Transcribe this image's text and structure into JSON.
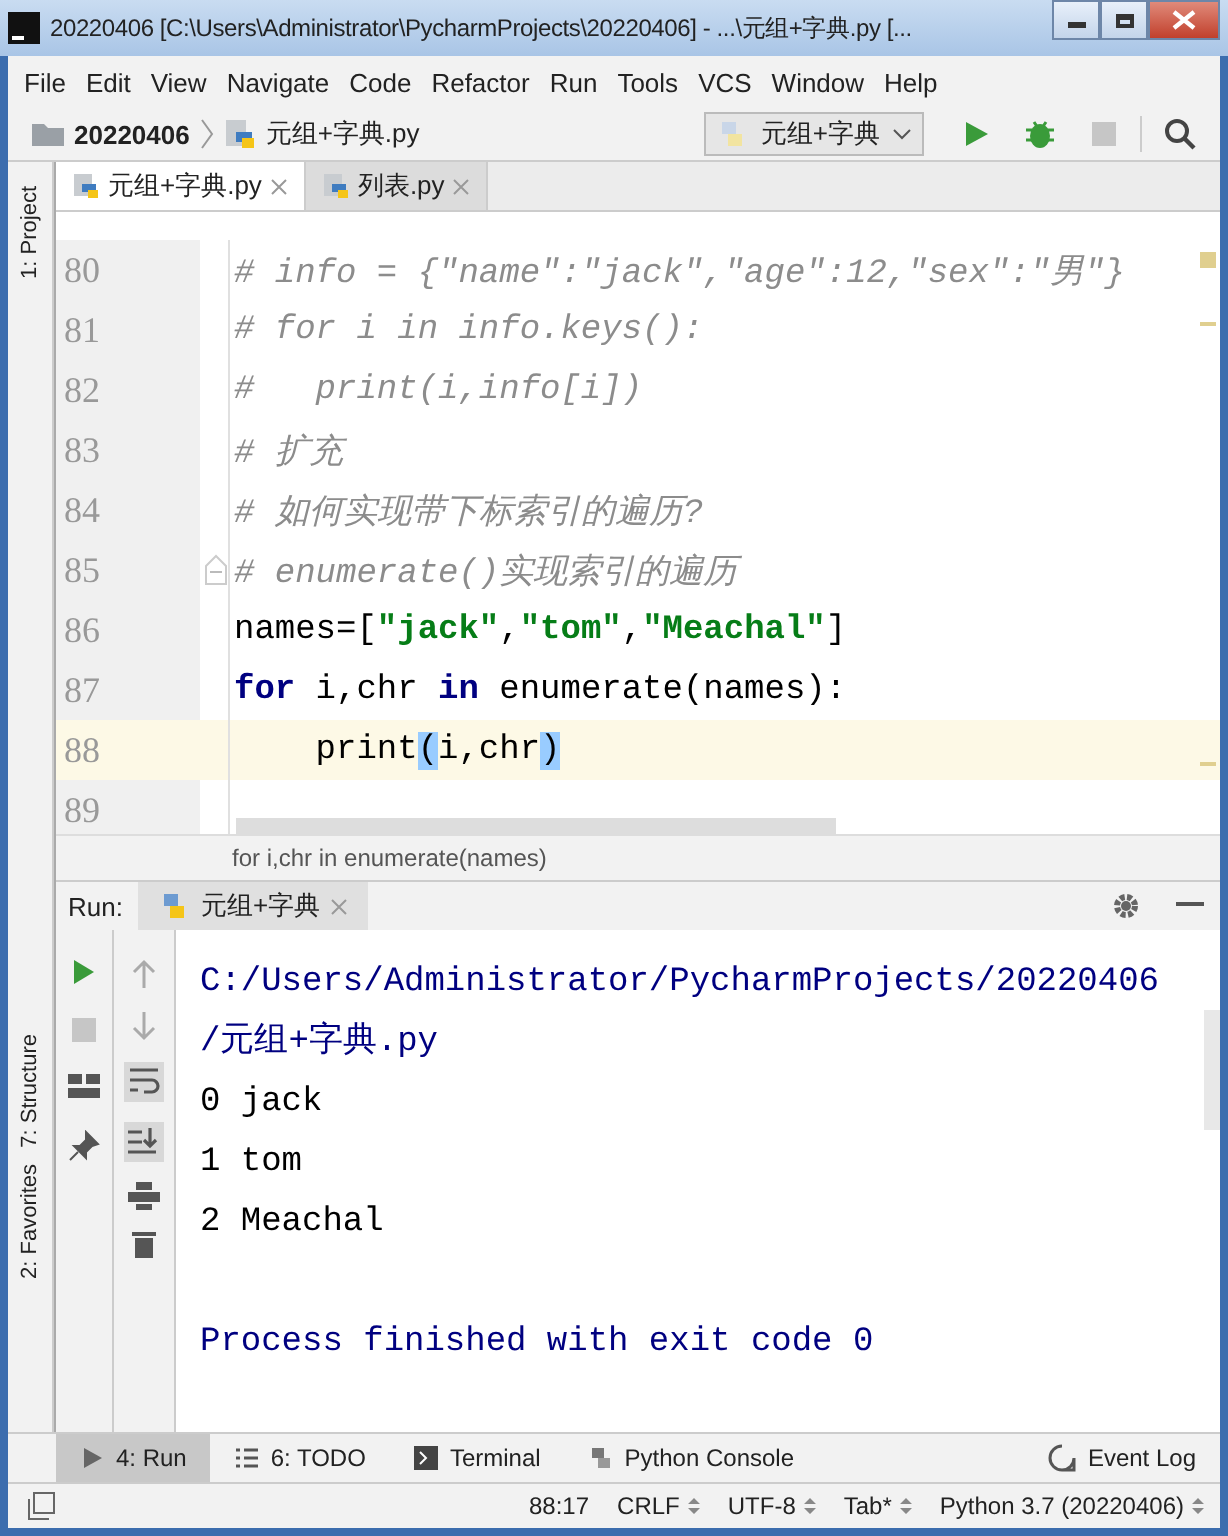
{
  "window": {
    "title": "20220406 [C:\\Users\\Administrator\\PycharmProjects\\20220406] - ...\\元组+字典.py [..."
  },
  "menu": [
    "File",
    "Edit",
    "View",
    "Navigate",
    "Code",
    "Refactor",
    "Run",
    "Tools",
    "VCS",
    "Window",
    "Help"
  ],
  "navbar": {
    "project": "20220406",
    "file": "元组+字典.py",
    "run_config": "元组+字典"
  },
  "side_tabs_left": [
    {
      "label": "1: Project",
      "selected": false
    },
    {
      "label": "7: Structure",
      "selected": false
    },
    {
      "label": "2: Favorites",
      "selected": false
    }
  ],
  "editor_tabs": [
    {
      "label": "元组+字典.py",
      "selected": true
    },
    {
      "label": "列表.py",
      "selected": false
    }
  ],
  "code_lines": [
    {
      "number": "80",
      "current": false,
      "fold": false,
      "tokens": [
        {
          "kind": "comment",
          "text": "# info = {\"name\":\"jack\",\"age\":12,\"sex\":\"男\"}"
        }
      ]
    },
    {
      "number": "81",
      "current": false,
      "fold": false,
      "tokens": [
        {
          "kind": "comment",
          "text": "# for i in info.keys():"
        }
      ]
    },
    {
      "number": "82",
      "current": false,
      "fold": false,
      "tokens": [
        {
          "kind": "comment",
          "text": "#   print(i,info[i])"
        }
      ]
    },
    {
      "number": "83",
      "current": false,
      "fold": false,
      "tokens": [
        {
          "kind": "comment",
          "text": "# 扩充"
        }
      ]
    },
    {
      "number": "84",
      "current": false,
      "fold": false,
      "tokens": [
        {
          "kind": "comment",
          "text": "# 如何实现带下标索引的遍历?"
        }
      ]
    },
    {
      "number": "85",
      "current": false,
      "fold": true,
      "tokens": [
        {
          "kind": "comment",
          "text": "# enumerate()实现索引的遍历"
        }
      ]
    },
    {
      "number": "86",
      "current": false,
      "fold": false,
      "tokens": [
        {
          "kind": "plain",
          "text": "names=["
        },
        {
          "kind": "string",
          "text": "\"jack\""
        },
        {
          "kind": "plain",
          "text": ","
        },
        {
          "kind": "string",
          "text": "\"tom\""
        },
        {
          "kind": "plain",
          "text": ","
        },
        {
          "kind": "string",
          "text": "\"Meachal\""
        },
        {
          "kind": "plain",
          "text": "]"
        }
      ]
    },
    {
      "number": "87",
      "current": false,
      "fold": false,
      "tokens": [
        {
          "kind": "keyword",
          "text": "for"
        },
        {
          "kind": "plain",
          "text": " i,chr "
        },
        {
          "kind": "keyword",
          "text": "in"
        },
        {
          "kind": "plain",
          "text": " enumerate(names):"
        }
      ]
    },
    {
      "number": "88",
      "current": true,
      "fold": false,
      "tokens": [
        {
          "kind": "plain",
          "text": "    print"
        },
        {
          "kind": "match",
          "text": "("
        },
        {
          "kind": "plain",
          "text": "i,chr"
        },
        {
          "kind": "match",
          "text": ")"
        }
      ]
    },
    {
      "number": "89",
      "current": false,
      "fold": false
    }
  ],
  "breadcrumb": "for i,chr in enumerate(names)",
  "run_panel": {
    "label": "Run:",
    "tab": "元组+字典",
    "output": [
      {
        "kind": "normal",
        "blank_line_before": false,
        "text": "C:/Users/Administrator/PycharmProjects/20220406"
      },
      {
        "kind": "normal",
        "blank_line_before": false,
        "text": "/元组+字典.py"
      },
      {
        "kind": "plain",
        "blank_line_before": false,
        "text": "0 jack"
      },
      {
        "kind": "plain",
        "blank_line_before": false,
        "text": "1 tom"
      },
      {
        "kind": "plain",
        "blank_line_before": false,
        "text": "2 Meachal"
      },
      {
        "kind": "normal",
        "blank_line_before": true,
        "text": "Process finished with exit code 0"
      }
    ]
  },
  "tool_tabs": [
    {
      "label": "4: Run",
      "selected": true
    },
    {
      "label": "6: TODO",
      "selected": false
    },
    {
      "label": "Terminal",
      "selected": false
    },
    {
      "label": "Python Console",
      "selected": false
    }
  ],
  "event_log": "Event Log",
  "status_bar": [
    "88:17",
    "CRLF",
    "UTF-8",
    "Tab*",
    "Python 3.7 (20220406)"
  ]
}
